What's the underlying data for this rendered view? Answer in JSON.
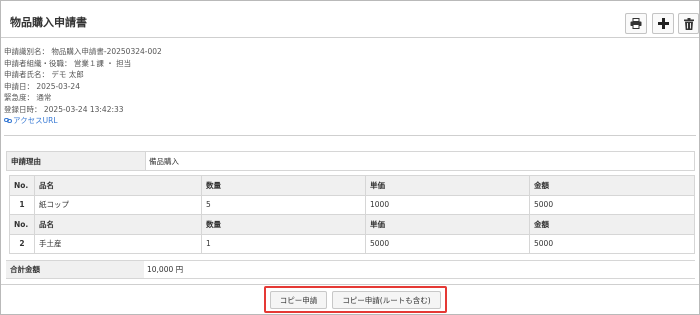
{
  "header": {
    "title": "物品購入申請書",
    "tools": [
      "printer-icon",
      "plus-icon",
      "trash-icon"
    ]
  },
  "meta": [
    "申請識別名： 物品購入申請書-20250324-002",
    "申請者組織・役職： 営業１課 ・ 担当",
    "申請者氏名： デモ 太郎",
    "申請日： 2025-03-24",
    "緊急度： 通常",
    "登録日時： 2025-03-24 13:42:33"
  ],
  "access_link": "アクセスURL",
  "reason": {
    "label": "申請理由",
    "value": "備品購入"
  },
  "items": {
    "headers": [
      "No.",
      "品名",
      "数量",
      "単価",
      "金額"
    ],
    "rows": [
      {
        "no": "1",
        "name": "紙コップ",
        "qty": "5",
        "price": "1000",
        "amount": "5000"
      },
      {
        "no": "2",
        "name": "手土産",
        "qty": "1",
        "price": "5000",
        "amount": "5000"
      }
    ]
  },
  "total": {
    "label": "合計金額",
    "value": "10,000 円"
  },
  "actions": {
    "copy": "コピー申請",
    "copy_route": "コピー申請(ルートも含む)"
  },
  "colors": {
    "highlight": "#e53935",
    "link": "#3a7bd5",
    "label_bg": "#f0f0f0"
  }
}
